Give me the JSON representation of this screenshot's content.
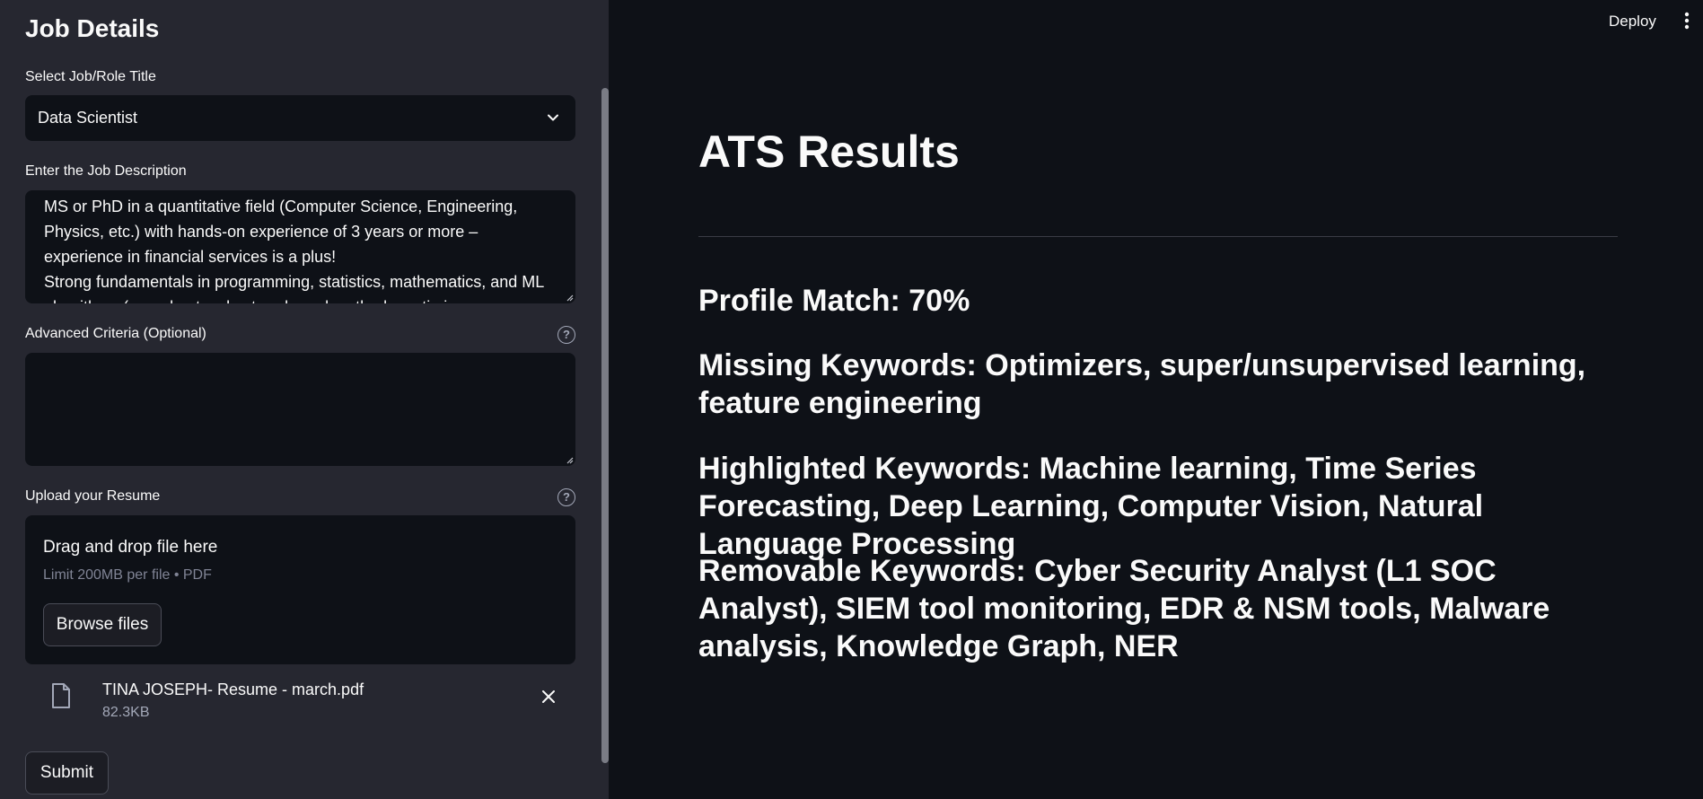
{
  "sidebar": {
    "title": "Job Details",
    "job_select": {
      "label": "Select Job/Role Title",
      "value": "Data Scientist"
    },
    "job_description": {
      "label": "Enter the Job Description",
      "value": "MS or PhD in a quantitative field (Computer Science, Engineering, Physics, etc.) with hands-on experience of 3 years or more – experience in financial services is a plus!\nStrong fundamentals in programming, statistics, mathematics, and ML algorithms (neural networks, tree-based methods, optimizers, ..."
    },
    "advanced_criteria": {
      "label": "Advanced Criteria (Optional)",
      "value": ""
    },
    "upload": {
      "label": "Upload your Resume",
      "drop_text": "Drag and drop file here",
      "limit_text": "Limit 200MB per file • PDF",
      "browse_label": "Browse files"
    },
    "uploaded_file": {
      "name": "TINA JOSEPH- Resume - march.pdf",
      "size": "82.3KB"
    },
    "submit_label": "Submit"
  },
  "header": {
    "deploy_label": "Deploy"
  },
  "main": {
    "title": "ATS Results",
    "profile_match": "Profile Match: 70%",
    "missing_keywords": "Missing Keywords: Optimizers, super/unsupervised learning, feature engineering",
    "highlighted_keywords": "Highlighted Keywords: Machine learning, Time Series Forecasting, Deep Learning, Computer Vision, Natural Language Processing",
    "removable_keywords": "Removable Keywords: Cyber Security Analyst (L1 SOC Analyst), SIEM tool monitoring, EDR & NSM tools, Malware analysis, Knowledge Graph, NER"
  },
  "colors": {
    "background": "#0e1117",
    "sidebar": "#262730",
    "text": "#fafafa",
    "muted": "#808495"
  }
}
